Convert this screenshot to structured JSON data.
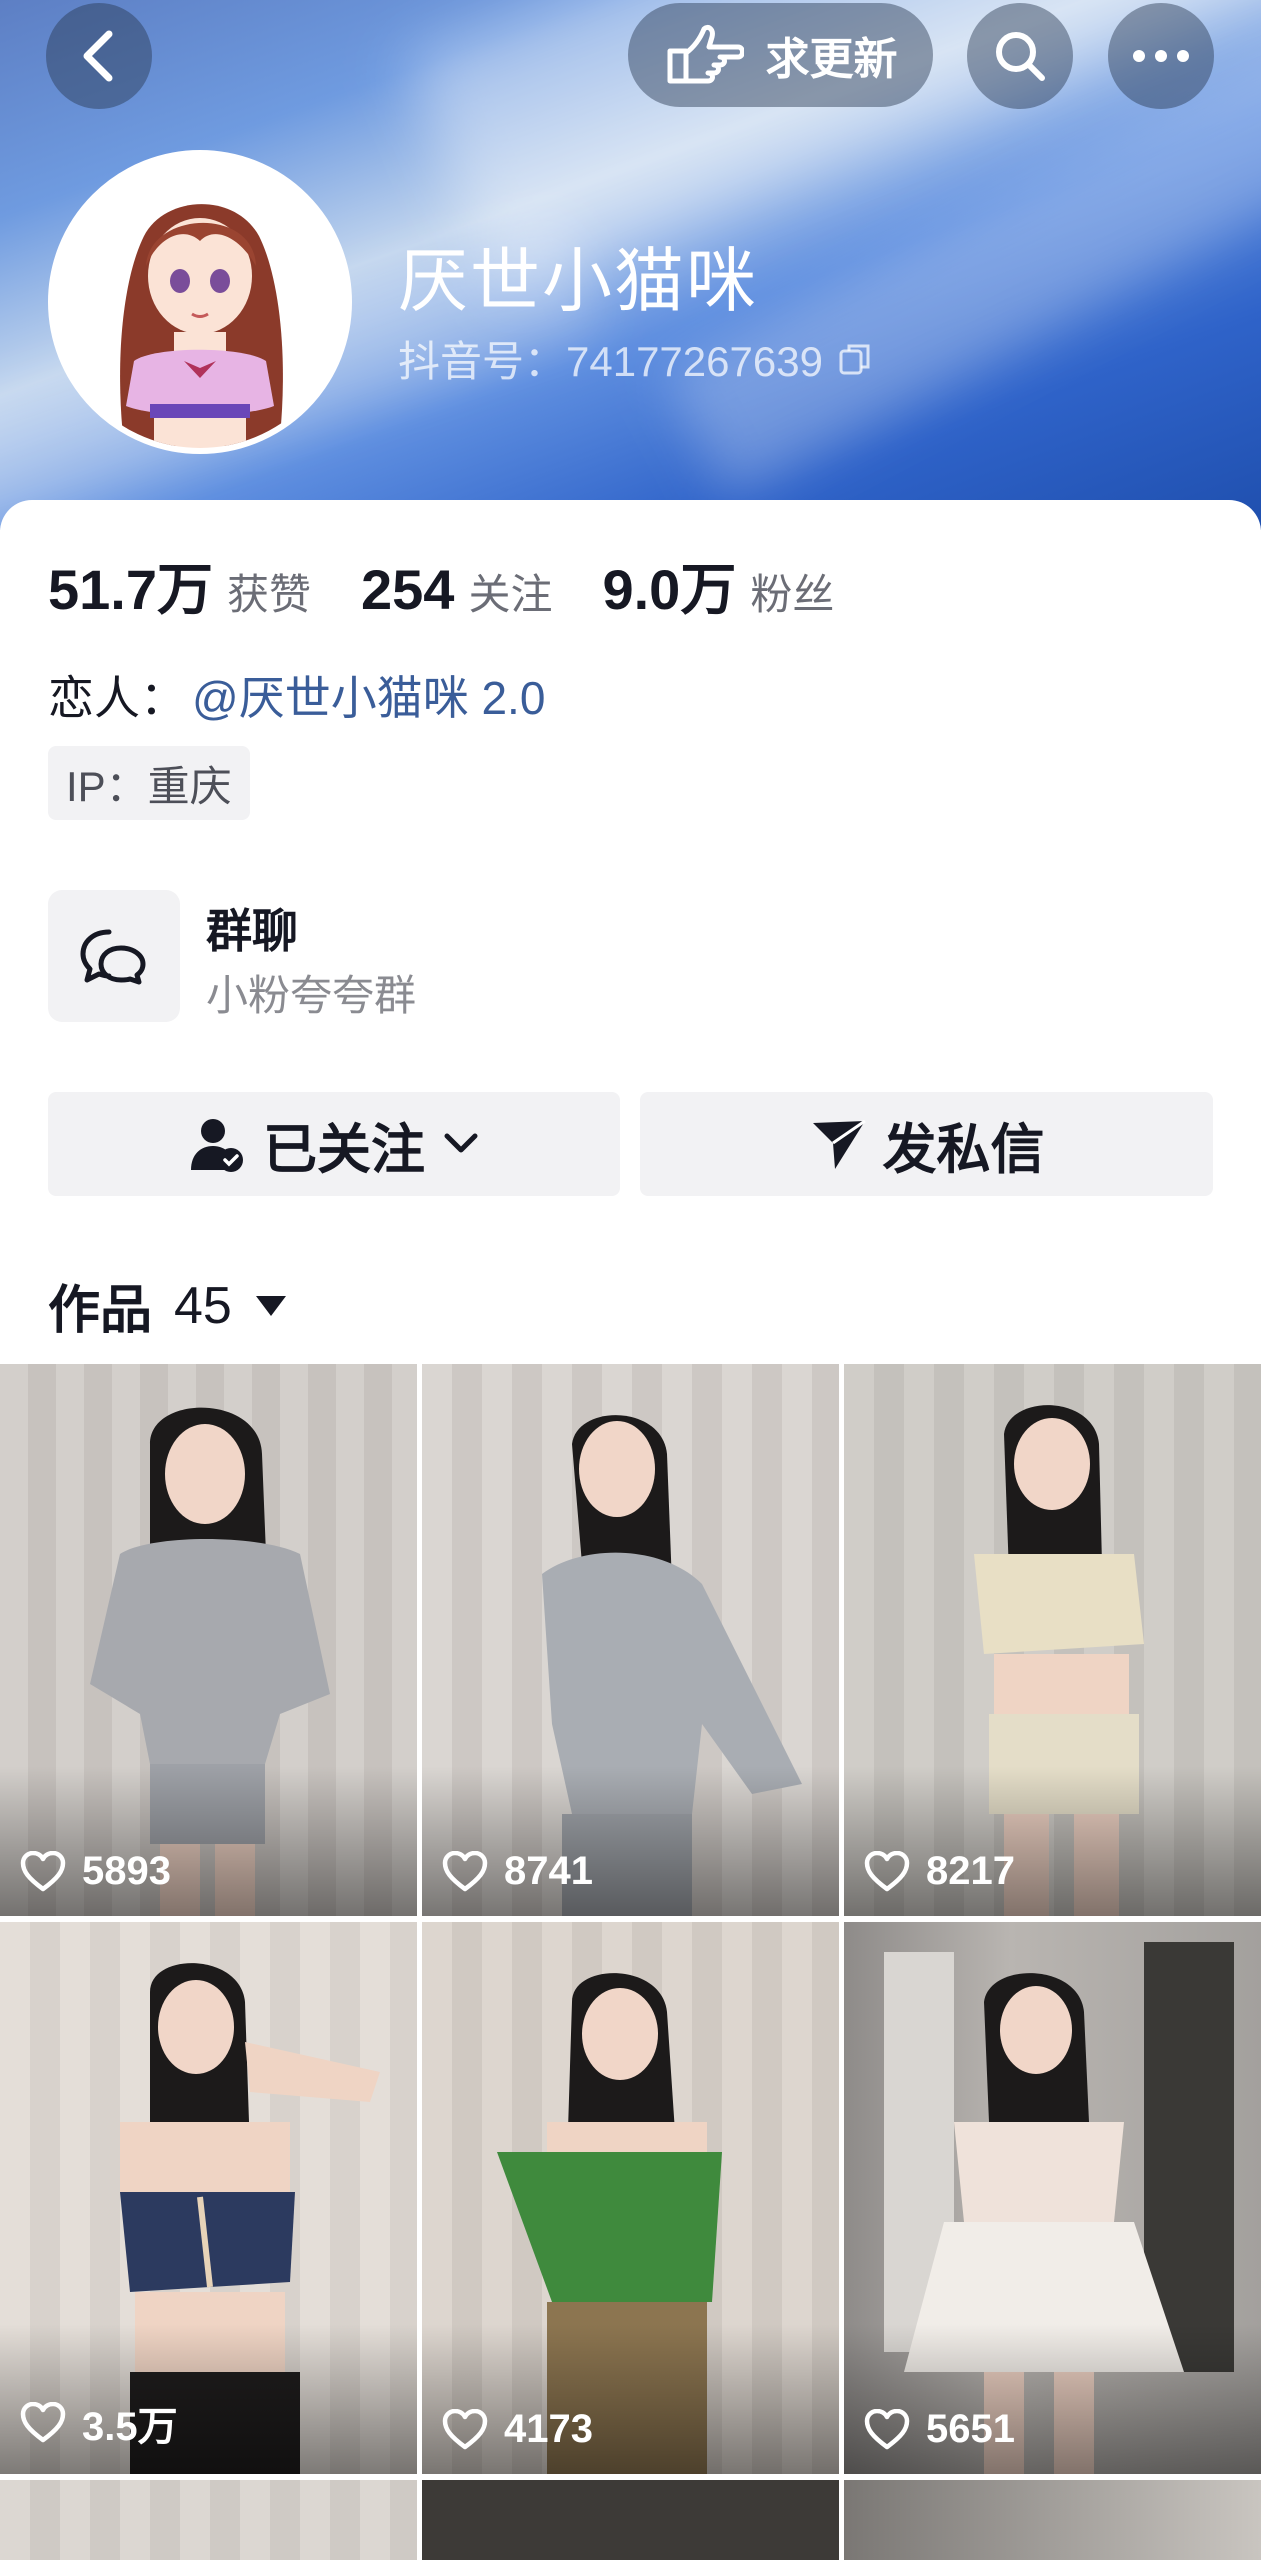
{
  "header": {
    "update_label": "求更新",
    "icons": [
      "back-arrow-icon",
      "pointing-hand-icon",
      "search-icon",
      "more-dots-icon"
    ]
  },
  "profile": {
    "name": "厌世小猫咪",
    "id_text": "抖音号：74177267639",
    "avatar": "anime-girl-avatar"
  },
  "stats": [
    {
      "num": "51.7万",
      "label": "获赞"
    },
    {
      "num": "254",
      "label": "关注"
    },
    {
      "num": "9.0万",
      "label": "粉丝"
    }
  ],
  "lover": {
    "prefix": "恋人：",
    "link": "@厌世小猫咪 2.0"
  },
  "ip": "IP：重庆",
  "group": {
    "title": "群聊",
    "subtitle": "小粉夸夸群"
  },
  "actions": {
    "follow_label": "已关注",
    "message_label": "发私信"
  },
  "works": {
    "label": "作品",
    "count": "45"
  },
  "videos": [
    {
      "likes": "5893",
      "colors": {
        "bg": "#cfcac6",
        "top": "#a7a9ae"
      }
    },
    {
      "likes": "8741",
      "colors": {
        "bg": "#d7d3cf",
        "top": "#a9adb3"
      }
    },
    {
      "likes": "8217",
      "colors": {
        "bg": "#cdcac5",
        "top": "#e8dfc5"
      }
    },
    {
      "likes": "3.5万",
      "colors": {
        "bg": "#e2dcd6",
        "top": "#2c3a5f"
      }
    },
    {
      "likes": "4173",
      "colors": {
        "bg": "#d9d2cb",
        "top": "#3f8a3d"
      }
    },
    {
      "likes": "5651",
      "colors": {
        "bg": "#9d9a97",
        "top": "#efe2da"
      }
    }
  ],
  "colors": {
    "accent_link": "#3a5d99",
    "banner_blue": "#2f63c9"
  }
}
